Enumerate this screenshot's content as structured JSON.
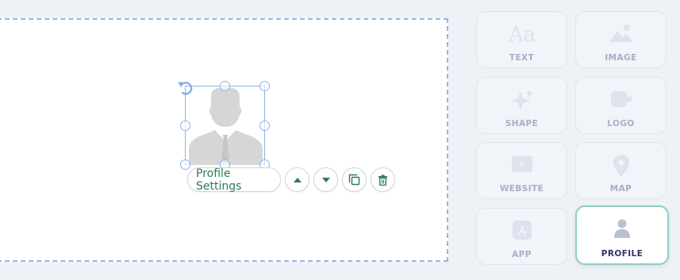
{
  "toolbar": {
    "settings_label": "Profile Settings",
    "move_up_icon": "triangle-up-icon",
    "move_down_icon": "triangle-down-icon",
    "duplicate_icon": "copy-icon",
    "delete_icon": "trash-icon"
  },
  "elements_panel": {
    "items": [
      {
        "label": "TEXT",
        "icon": "text-aa-icon"
      },
      {
        "label": "IMAGE",
        "icon": "image-icon"
      },
      {
        "label": "SHAPE",
        "icon": "sparkle-icon"
      },
      {
        "label": "LOGO",
        "icon": "logo-icon"
      },
      {
        "label": "WEBSITE",
        "icon": "website-icon"
      },
      {
        "label": "MAP",
        "icon": "map-pin-icon"
      },
      {
        "label": "APP",
        "icon": "app-store-icon"
      },
      {
        "label": "PROFILE",
        "icon": "person-icon"
      }
    ],
    "selected": "PROFILE"
  },
  "colors": {
    "accent": "#2b7a55",
    "selection": "#8fb2ea",
    "active_tile_border": "#8dcfc4",
    "inactive_label": "#a8aec8"
  }
}
